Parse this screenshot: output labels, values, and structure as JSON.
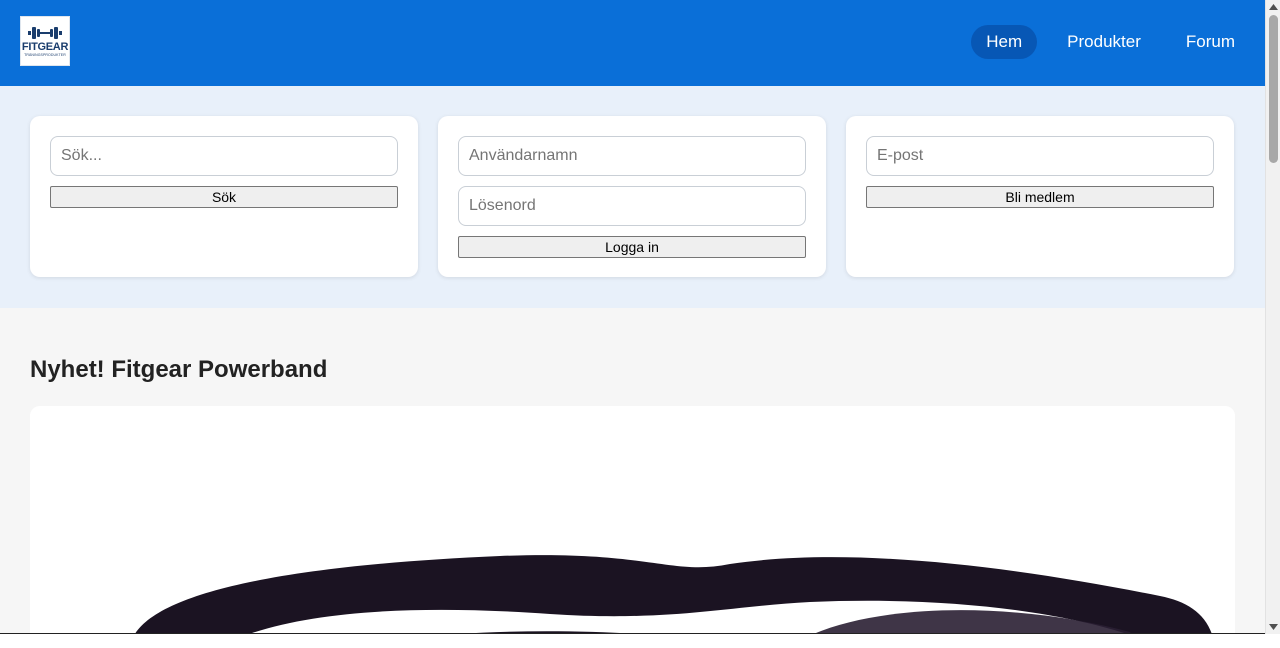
{
  "header": {
    "logo": {
      "text": "FITGEAR",
      "subtext": "TRÄNINGSPRODUKTER",
      "icon": "dumbbell-icon"
    },
    "nav": [
      {
        "label": "Hem",
        "active": true
      },
      {
        "label": "Produkter",
        "active": false
      },
      {
        "label": "Forum",
        "active": false
      }
    ],
    "color": "#0a6fd8"
  },
  "search": {
    "placeholder": "Sök...",
    "value": "",
    "button": "Sök"
  },
  "login": {
    "username_placeholder": "Användarnamn",
    "password_placeholder": "Lösenord",
    "button": "Logga in"
  },
  "signup": {
    "email_placeholder": "E-post",
    "button": "Bli medlem"
  },
  "main": {
    "heading": "Nyhet! Fitgear Powerband",
    "product_image": "powerband-image"
  },
  "colors": {
    "accent": "#0a6fd8",
    "nav_active": "#0757b5",
    "band_bg": "#e8f0fa",
    "page_bg": "#f6f6f6"
  }
}
